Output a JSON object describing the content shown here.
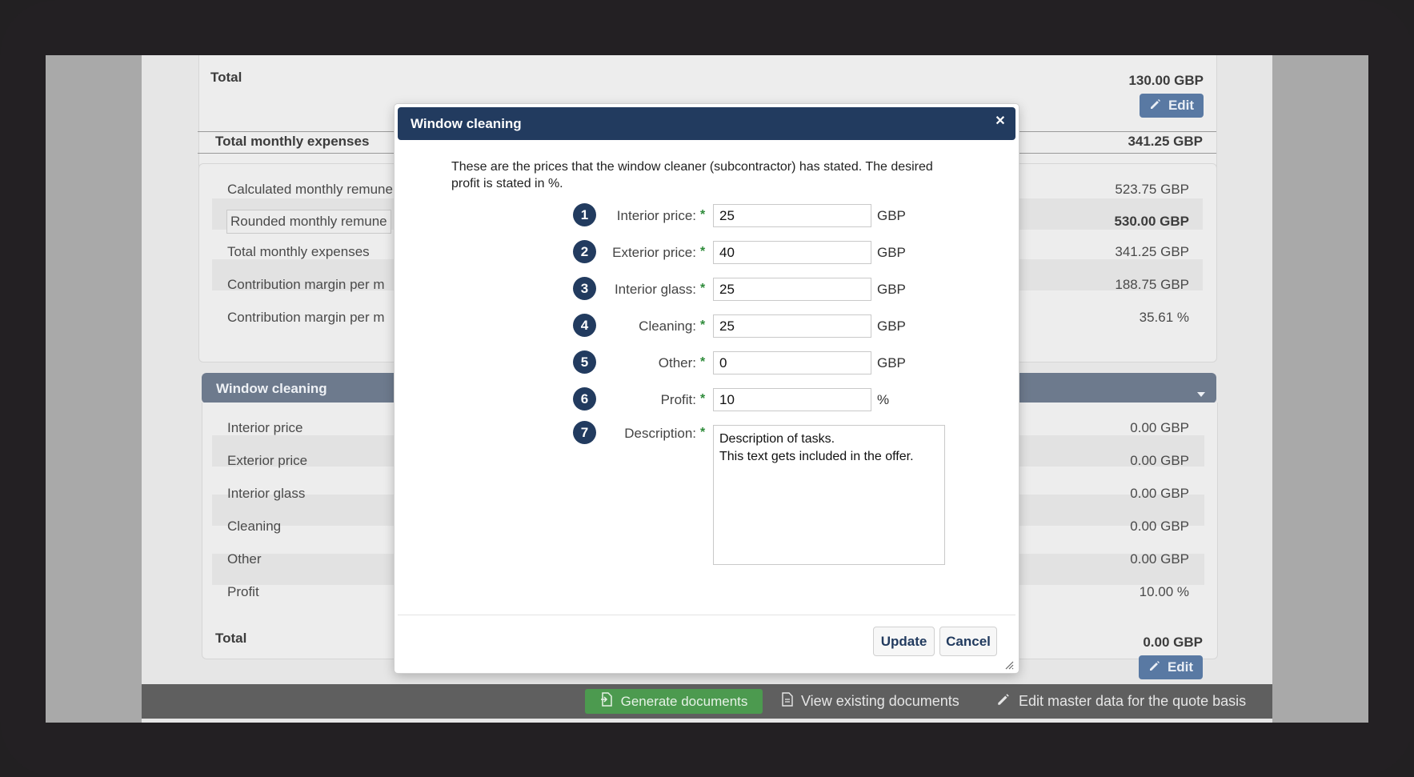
{
  "background": {
    "top_card": {
      "total_label": "Total",
      "total_value": "130.00 GBP",
      "edit_label": "Edit"
    },
    "total_expenses": {
      "label": "Total monthly expenses",
      "value": "341.25 GBP"
    },
    "summary_rows": [
      {
        "label": "Calculated monthly remune",
        "value": "523.75 GBP",
        "bold": false
      },
      {
        "label": "Rounded monthly remune",
        "value": "530.00 GBP",
        "bold": true
      },
      {
        "label": "Total monthly expenses",
        "value": "341.25 GBP",
        "bold": false
      },
      {
        "label": "Contribution margin per m",
        "value": "188.75 GBP",
        "bold": false
      },
      {
        "label": "Contribution margin per m",
        "value": "35.61 %",
        "bold": false
      }
    ],
    "window_section": {
      "title": "Window cleaning",
      "rows": [
        {
          "label": "Interior price",
          "value": "0.00 GBP"
        },
        {
          "label": "Exterior price",
          "value": "0.00 GBP"
        },
        {
          "label": "Interior glass",
          "value": "0.00 GBP"
        },
        {
          "label": "Cleaning",
          "value": "0.00 GBP"
        },
        {
          "label": "Other",
          "value": "0.00 GBP"
        },
        {
          "label": "Profit",
          "value": "10.00 %"
        }
      ],
      "total_label": "Total",
      "total_value": "0.00 GBP",
      "edit_label": "Edit"
    }
  },
  "footer": {
    "generate_label": "Generate documents",
    "view_label": "View existing documents",
    "edit_master_label": "Edit master data for the quote basis"
  },
  "modal": {
    "title": "Window cleaning",
    "intro": "These are the prices that the window cleaner (subcontractor) has stated. The desired profit is stated in %.",
    "fields": [
      {
        "num": "1",
        "label": "Interior price:",
        "value": "25",
        "unit": "GBP"
      },
      {
        "num": "2",
        "label": "Exterior price:",
        "value": "40",
        "unit": "GBP"
      },
      {
        "num": "3",
        "label": "Interior glass:",
        "value": "25",
        "unit": "GBP"
      },
      {
        "num": "4",
        "label": "Cleaning:",
        "value": "25",
        "unit": "GBP"
      },
      {
        "num": "5",
        "label": "Other:",
        "value": "0",
        "unit": "GBP"
      },
      {
        "num": "6",
        "label": "Profit:",
        "value": "10",
        "unit": "%"
      }
    ],
    "description": {
      "num": "7",
      "label": "Description:",
      "value": "Description of tasks.\nThis text gets included in the offer."
    },
    "required_mark": "*",
    "update_label": "Update",
    "cancel_label": "Cancel",
    "colors": {
      "header": "#223b5f",
      "required": "#2e8b3a",
      "generate_button": "#4c9a4f"
    }
  }
}
